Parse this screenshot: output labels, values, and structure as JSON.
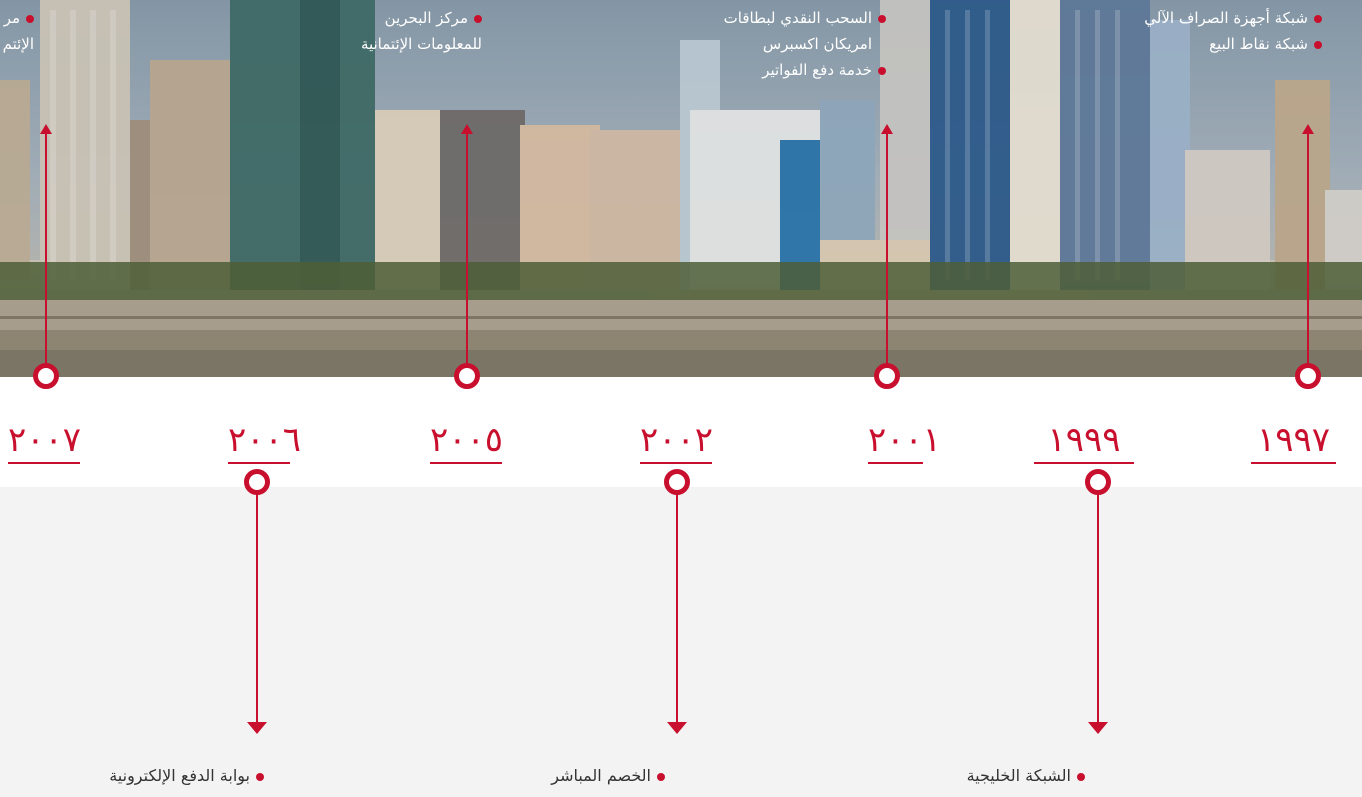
{
  "timeline": {
    "accent_color": "#c8102e",
    "years": [
      {
        "label": "١٩٩٧",
        "items": [
          "شبكة أجهزة الصراف الآلي",
          "شبكة نقاط البيع"
        ]
      },
      {
        "label": "١٩٩٩",
        "items": [
          "الشبكة الخليجية"
        ]
      },
      {
        "label": "٢٠٠١",
        "items": [
          "السحب النقدي لبطاقات",
          "امريكان اكسبرس",
          "خدمة دفع الفواتير"
        ]
      },
      {
        "label": "٢٠٠٢",
        "items": [
          "الخصم المباشر"
        ]
      },
      {
        "label": "٢٠٠٥",
        "items": [
          "مركز البحرين",
          "للمعلومات الإئتمانية"
        ]
      },
      {
        "label": "٢٠٠٦",
        "items": [
          "بوابة الدفع الإلكترونية"
        ]
      },
      {
        "label": "٢٠٠٧",
        "items": [
          "مر",
          "الإئتم"
        ]
      }
    ]
  }
}
